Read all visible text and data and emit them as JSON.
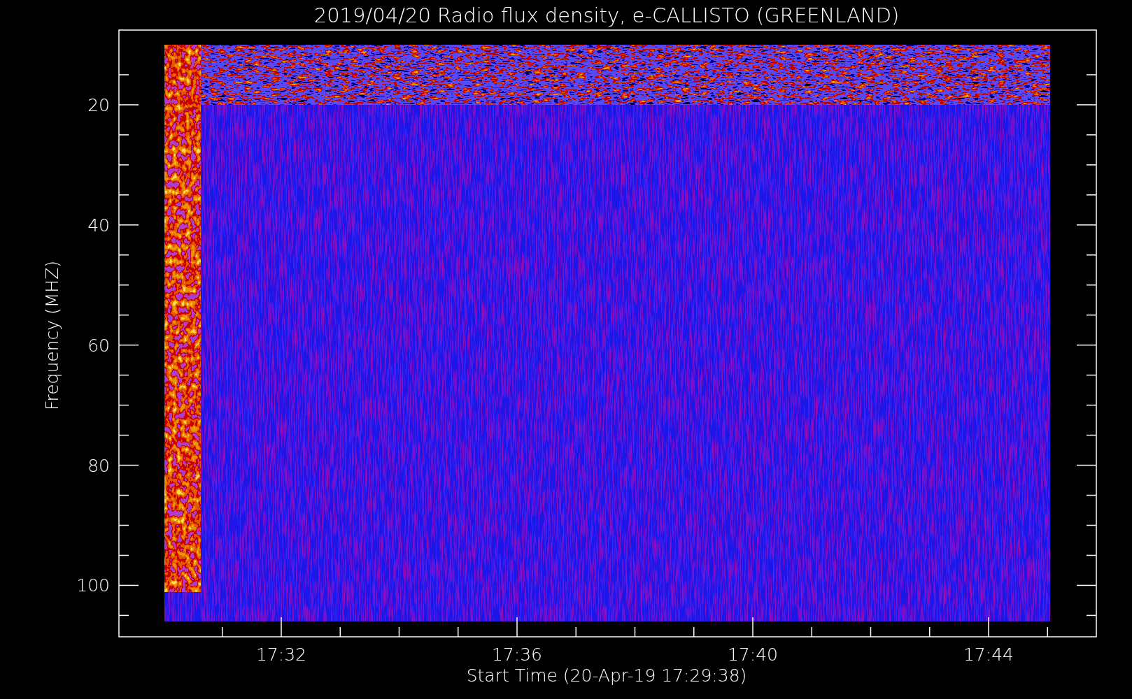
{
  "title": "2019/04/20  Radio flux density, e-CALLISTO (GREENLAND)",
  "y_axis": {
    "label": "Frequency (MHZ)",
    "ticks": [
      "20",
      "40",
      "60",
      "80",
      "100"
    ]
  },
  "x_axis": {
    "label": "Start Time (20-Apr-19 17:29:38)",
    "ticks": [
      "17:32",
      "17:36",
      "17:40",
      "17:44"
    ]
  }
}
